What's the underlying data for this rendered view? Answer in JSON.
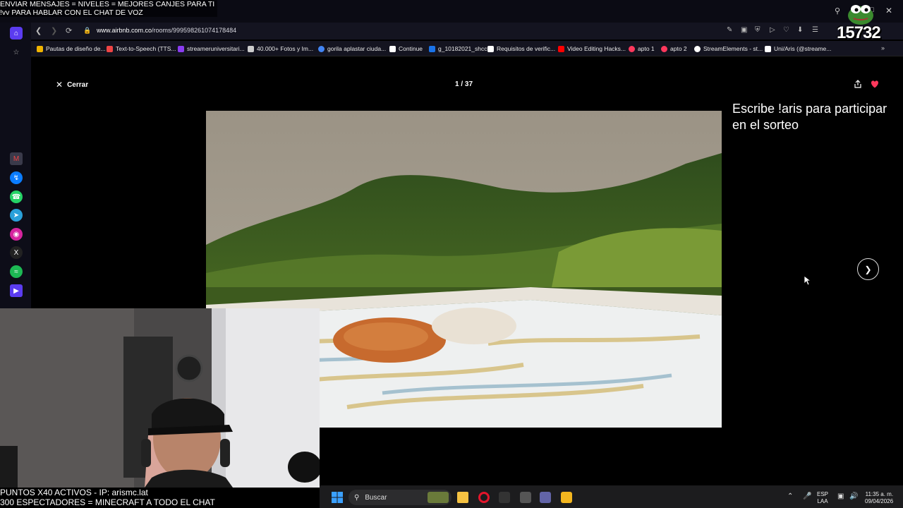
{
  "stream_overlay": {
    "top_line_1": "ENVIAR MENSAJES = NIVELES = MEJORES CANJES PARA TI",
    "top_line_2": "!vv PARA HABLAR CON EL CHAT DE VOZ",
    "bottom_line_1": "PUNTOS X40 ACTIVOS - IP: arismc.lat",
    "bottom_line_2": "300 ESPECTADORES = MINECRAFT A TODO EL CHAT",
    "raffle_line_1": "Escribe !aris para participar",
    "raffle_line_2": "en el sorteo",
    "follower_count": "15732"
  },
  "browser": {
    "url_domain": "www.airbnb.com.co",
    "url_path": "/rooms/999598261074178484",
    "bookmarks": [
      {
        "label": "Pautas de diseño de...",
        "color": "#f0b400"
      },
      {
        "label": "Text-to-Speech (TTS...",
        "color": "#e44"
      },
      {
        "label": "streameruniversitari...",
        "color": "#8a3cf0"
      },
      {
        "label": "40.000+ Fotos y Im...",
        "color": "#ccc"
      },
      {
        "label": "gorila aplastar ciuda...",
        "color": "#4285f4"
      },
      {
        "label": "Continue",
        "color": "#fff"
      },
      {
        "label": "g_10182021_shcc",
        "color": "#1a73e8"
      },
      {
        "label": "Requisitos de verific...",
        "color": "#fff"
      },
      {
        "label": "Video Editing Hacks...",
        "color": "#f00"
      },
      {
        "label": "apto 1",
        "color": "#ff385c"
      },
      {
        "label": "apto 2",
        "color": "#ff385c"
      },
      {
        "label": "StreamElements - st...",
        "color": "#fff"
      },
      {
        "label": "Uni/Aris (@streame...",
        "color": "#fff"
      }
    ]
  },
  "gallery": {
    "close_label": "Cerrar",
    "counter": "1 / 37"
  },
  "taskbar": {
    "search_placeholder": "Buscar",
    "lang_1": "ESP",
    "lang_2": "LAA",
    "time": "11:35 a. m.",
    "date": "09/04/2026"
  },
  "colors": {
    "airbnb_heart": "#ff385c",
    "browser_bg": "#141420"
  }
}
